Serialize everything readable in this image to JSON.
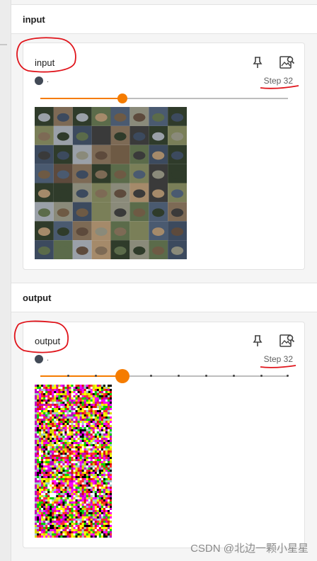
{
  "sections": [
    {
      "header": "input",
      "card": {
        "title": "input",
        "run_label": ".",
        "step_label": "Step 32",
        "slider_fraction": 0.33,
        "image_description_grid": "8x8 CIFAR image grid"
      }
    },
    {
      "header": "output",
      "card": {
        "title": "output",
        "run_label": ".",
        "step_label": "Step 32",
        "slider_fraction": 0.33
      }
    }
  ],
  "watermark": "CSDN @北边一颗小星星",
  "colors": {
    "accent": "#f57c00",
    "annotation_red": "#e0141b",
    "run_dot": "#424a56"
  },
  "icons": [
    "pin-icon",
    "expand-image-icon"
  ]
}
